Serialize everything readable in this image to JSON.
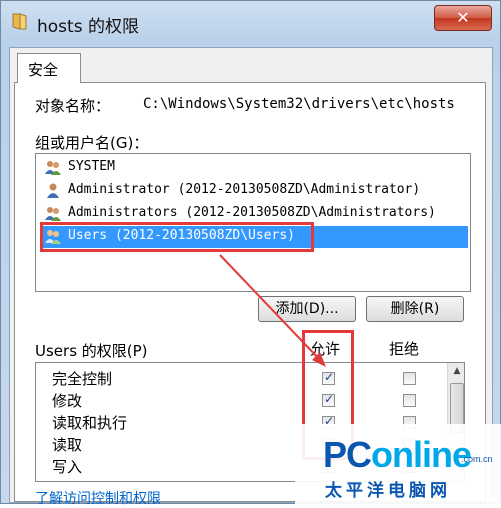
{
  "window": {
    "title": "hosts 的权限",
    "close_glyph": "✕"
  },
  "tabs": [
    {
      "label": "安全"
    }
  ],
  "object": {
    "label": "对象名称：",
    "path": "C:\\Windows\\System32\\drivers\\etc\\hosts"
  },
  "groups": {
    "label": "组或用户名(G)：",
    "items": [
      {
        "name": "SYSTEM",
        "icon": "users-icon",
        "selected": false
      },
      {
        "name": "Administrator (2012-20130508ZD\\Administrator)",
        "icon": "user-icon",
        "selected": false
      },
      {
        "name": "Administrators (2012-20130508ZD\\Administrators)",
        "icon": "users-icon",
        "selected": false
      },
      {
        "name": "Users (2012-20130508ZD\\Users)",
        "icon": "users-icon",
        "selected": true
      }
    ],
    "add_button": "添加(D)...",
    "remove_button": "删除(R)"
  },
  "permissions": {
    "label": "Users 的权限(P)",
    "allow_header": "允许",
    "deny_header": "拒绝",
    "rows": [
      {
        "name": "完全控制",
        "allow": true,
        "deny": false
      },
      {
        "name": "修改",
        "allow": true,
        "deny": false
      },
      {
        "name": "读取和执行",
        "allow": true,
        "deny": false
      },
      {
        "name": "读取",
        "allow": true,
        "deny": false
      },
      {
        "name": "写入",
        "allow": true,
        "deny": false
      }
    ]
  },
  "link": {
    "text": "了解访问控制和权限"
  },
  "watermark": {
    "logo_p": "PC",
    "logo_c": "online",
    "domain": ".com.cn",
    "subtitle": "太平洋电脑网"
  },
  "colors": {
    "selection": "#3399ff",
    "highlight_box": "#e23a3a",
    "link": "#0066cc"
  }
}
